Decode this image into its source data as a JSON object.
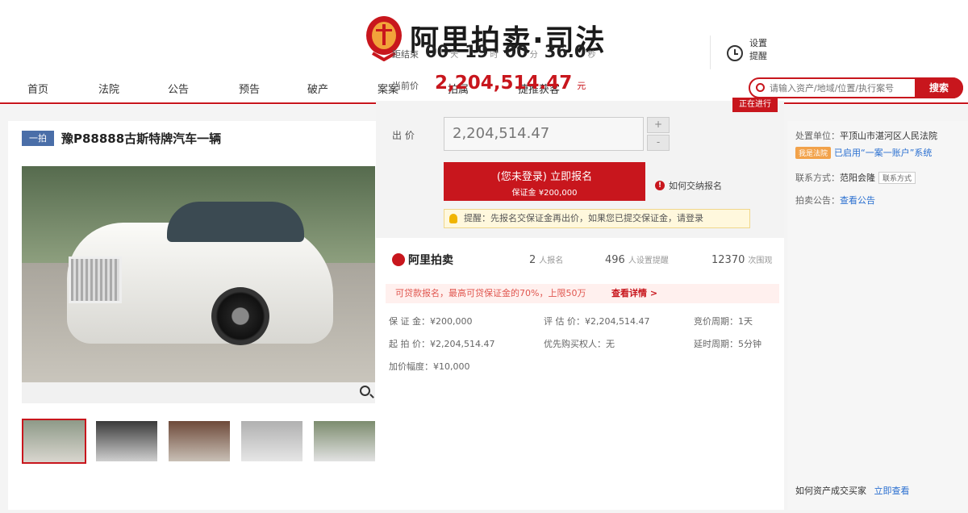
{
  "header": {
    "logo_text": "阿里拍卖·司法",
    "nav": [
      "首页",
      "法院",
      "公告",
      "预告",
      "破产",
      "案案",
      "拍属",
      "捷推获客"
    ],
    "search_placeholder": "请输入资产/地域/位置/执行案号",
    "search_button": "搜索"
  },
  "lot": {
    "badge": "一拍",
    "title": "豫P88888古斯特牌汽车一辆"
  },
  "auction": {
    "countdown_label": "距结束",
    "countdown": {
      "days": "00",
      "days_unit": "天",
      "hours": "19",
      "hours_unit": "时",
      "minutes": "00",
      "minutes_unit": "分",
      "seconds": "36.0",
      "seconds_unit": "秒"
    },
    "remind_label": "设置提醒",
    "price_label": "当前价",
    "current_price": "2,204,514.47",
    "price_unit": "元",
    "hot_tag": "正在进行",
    "bid_label": "出 价",
    "bid_value": "2,204,514.47",
    "stepper_up": "+",
    "stepper_down": "-",
    "signup_main": "(您未登录) 立即报名",
    "signup_sub": "保证金 ¥200,000",
    "how_link": "如何交纳报名",
    "tip": "提醒：先报名交保证金再出价，如果您已提交保证金，请登录"
  },
  "stats": {
    "brand": "阿里拍卖",
    "applicants": "2",
    "applicants_label": "人报名",
    "reminders": "496",
    "reminders_label": "人设置提醒",
    "views": "12370",
    "views_label": "次围观"
  },
  "loan": {
    "text": "可贷款报名，最高可贷保证金的70%，上限50万",
    "link": "查看详情 >"
  },
  "facts": {
    "deposit": "保 证 金：¥200,000",
    "start_price": "起 拍 价：¥2,204,514.47",
    "increment": "加价幅度：¥10,000",
    "appraisal": "评 估 价：¥2,204,514.47",
    "priority": "优先购买权人：无",
    "cycle": "竞价周期：1天",
    "delay": "延时周期：5分钟"
  },
  "side": {
    "court_label": "处置单位：",
    "court": "平顶山市湛河区人民法院",
    "badge": "我是法院",
    "link": "已启用“一案一账户”系统",
    "contact_label": "联系方式：",
    "contact": "范阳会隆",
    "contact_btn": "联系方式",
    "notice_label": "拍卖公告：",
    "notice_link": "查看公告",
    "bottom": "如何资产成交买家",
    "bottom_link": "立即查看"
  }
}
